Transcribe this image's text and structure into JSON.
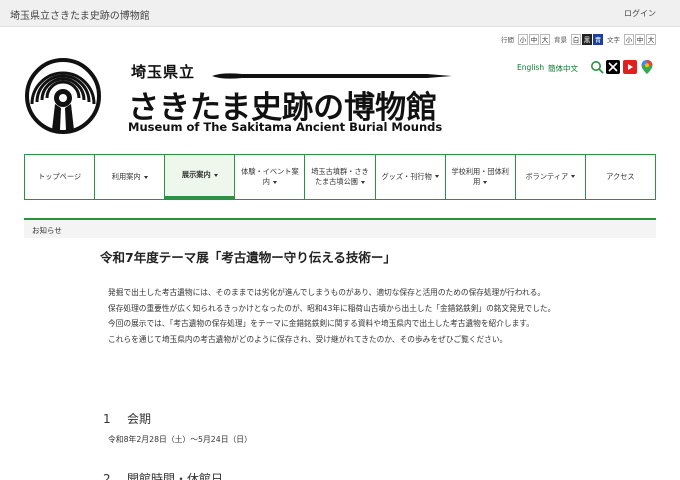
{
  "header": {
    "site_name": "埼玉県立さきたま史跡の博物館",
    "login_label": "ログイン"
  },
  "controls": {
    "line_height_label": "行間",
    "background_label": "背景",
    "text_label": "文字",
    "sizes": [
      "小",
      "中",
      "大"
    ],
    "bg_options": [
      "白",
      "黒",
      "青"
    ]
  },
  "brand": {
    "title_small": "埼玉県立",
    "title_large": "さきたま史跡の博物館",
    "title_en": "Museum of The Sakitama Ancient Burial Mounds",
    "logo_icon": "museum-logo-icon",
    "brand_color": "#2e9142"
  },
  "lang": {
    "english": "English",
    "chinese": "簡体中文"
  },
  "social": [
    "search-icon",
    "x-icon",
    "youtube-icon",
    "maps-icon"
  ],
  "nav": {
    "items": [
      {
        "label": "トップページ",
        "dropdown": false
      },
      {
        "label": "利用案内",
        "dropdown": true
      },
      {
        "label": "展示案内",
        "dropdown": true,
        "active": true
      },
      {
        "label": "体験・イベント案内",
        "dropdown": true
      },
      {
        "label": "埼玉古墳群・さきたま古墳公園",
        "dropdown": true
      },
      {
        "label": "グッズ・刊行物",
        "dropdown": true
      },
      {
        "label": "学校利用・団体利用",
        "dropdown": true
      },
      {
        "label": "ボランティア",
        "dropdown": true
      },
      {
        "label": "アクセス",
        "dropdown": false
      }
    ]
  },
  "breadcrumb": "お知らせ",
  "main": {
    "title": "令和7年度テーマ展「考古遺物ー守り伝える技術ー」",
    "paragraphs": [
      "発掘で出土した考古遺物には、そのままでは劣化が進んでしまうものがあり、適切な保存と活用のための保存処理が行われる。",
      "保存処理の重要性が広く知られるきっかけとなったのが、昭和43年に稲荷山古墳から出土した「金錯銘鉄剣」の銘文発見でした。",
      "今回の展示では、「考古遺物の保存処理」をテーマに金錯銘鉄剣に関する資料や埼玉県内で出土した考古遺物を紹介します。",
      "これらを通じて埼玉県内の考古遺物がどのように保存され、受け継がれてきたのか、その歩みをぜひご覧ください。"
    ],
    "section1": {
      "num": "1",
      "heading": "会期",
      "body": "令和8年2月28日（土）～5月24日（日）"
    },
    "section2": {
      "num": "2",
      "heading": "開館時間・休館日"
    }
  }
}
